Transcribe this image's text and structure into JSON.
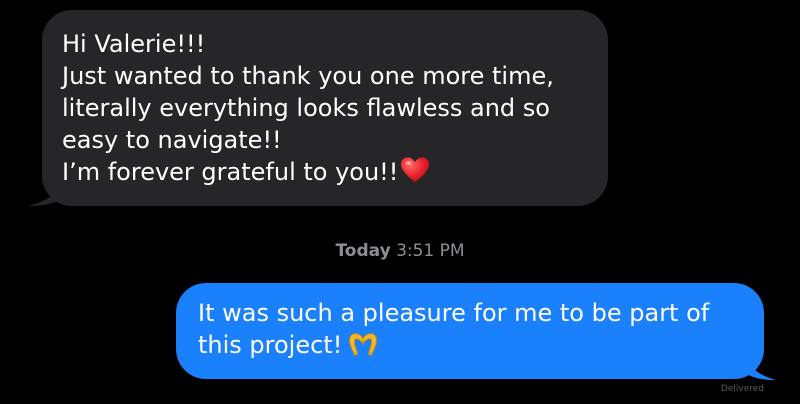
{
  "conversation": {
    "incoming": {
      "lines": [
        "Hi Valerie!!!",
        "Just wanted to thank you one more time,",
        "literally everything looks flawless and so",
        "easy to navigate!!",
        "I’m forever grateful to you!!"
      ],
      "emoji": "heart-icon"
    },
    "timestamp": {
      "day": "Today",
      "time": "3:51 PM"
    },
    "outgoing": {
      "lines": [
        "It was such a pleasure for me to be part of",
        "this project!"
      ],
      "emoji": "heart-hands-icon"
    },
    "status": "Delivered"
  },
  "colors": {
    "background": "#000000",
    "incoming_bubble": "#262628",
    "outgoing_bubble": "#1a80fb",
    "heart": "#e8202a",
    "heart_hands": "#f5b826",
    "timestamp": "#8e8e93"
  }
}
